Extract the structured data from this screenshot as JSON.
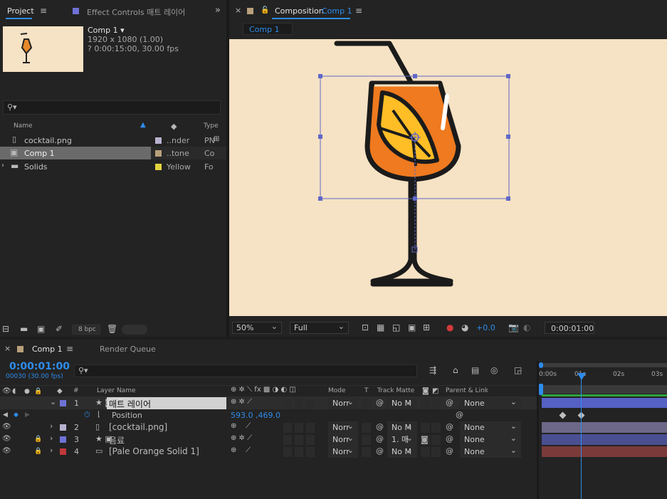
{
  "project_panel": {
    "tab_project": "Project",
    "tab_effect_controls": "Effect Controls 매트 레이어",
    "comp_name": "Comp 1 ▾",
    "comp_size": "1920 x 1080 (1.00)",
    "comp_duration": "? 0:00:15:00, 30.00 fps",
    "search_placeholder": "",
    "columns": {
      "name": "Name",
      "type": "Type"
    },
    "items": [
      {
        "name": "cocktail.png",
        "label_color": "#b9b2cf",
        "label": "..nder",
        "type": "PN"
      },
      {
        "name": "Comp 1",
        "label_color": "#b9a07c",
        "label": "..tone",
        "type": "Co"
      },
      {
        "name": "Solids",
        "label_color": "#e4d43f",
        "label": "Yellow",
        "type": "Fo"
      }
    ],
    "bpc": "8 bpc"
  },
  "composition_panel": {
    "tab_prefix": "Composition",
    "tab_comp": "Comp 1",
    "breadcrumb": "Comp 1",
    "zoom": "50%",
    "resolution": "Full",
    "exposure": "+0.0",
    "timecode": "0:00:01:00",
    "canvas_bg": "#f6e2c4"
  },
  "timeline_panel": {
    "tab_comp": "Comp 1",
    "tab_render": "Render Queue",
    "current_time": "0:00:01:00",
    "frame_info": "00030 (30.00 fps)",
    "columns": {
      "num": "#",
      "layer_name": "Layer Name",
      "mode": "Mode",
      "t": "T",
      "track_matte": "Track Matte",
      "parent": "Parent & Link"
    },
    "ruler": [
      "0:00s",
      "01s",
      "02s",
      "03s"
    ],
    "layers": [
      {
        "num": "1",
        "name": "매트 레이어",
        "color": "#6e72d6",
        "mode": "Norr",
        "matte": "No M",
        "parent": "None",
        "bar": "#5561c4"
      },
      {
        "num": "2",
        "name": "[cocktail.png]",
        "color": "#b9b2cf",
        "mode": "Norr",
        "matte": "No M",
        "parent": "None",
        "bar": "#6d6888"
      },
      {
        "num": "3",
        "name": "음료",
        "color": "#6e72d6",
        "mode": "Norr",
        "matte": "1. 매",
        "parent": "None",
        "bar": "#4a4f92"
      },
      {
        "num": "4",
        "name": "[Pale Orange Solid 1]",
        "color": "#c0383a",
        "mode": "Norr",
        "matte": "No M",
        "parent": "None",
        "bar": "#7a3a3a"
      }
    ],
    "position_prop": {
      "label": "Position",
      "value": "593.0 ,469.0"
    }
  }
}
